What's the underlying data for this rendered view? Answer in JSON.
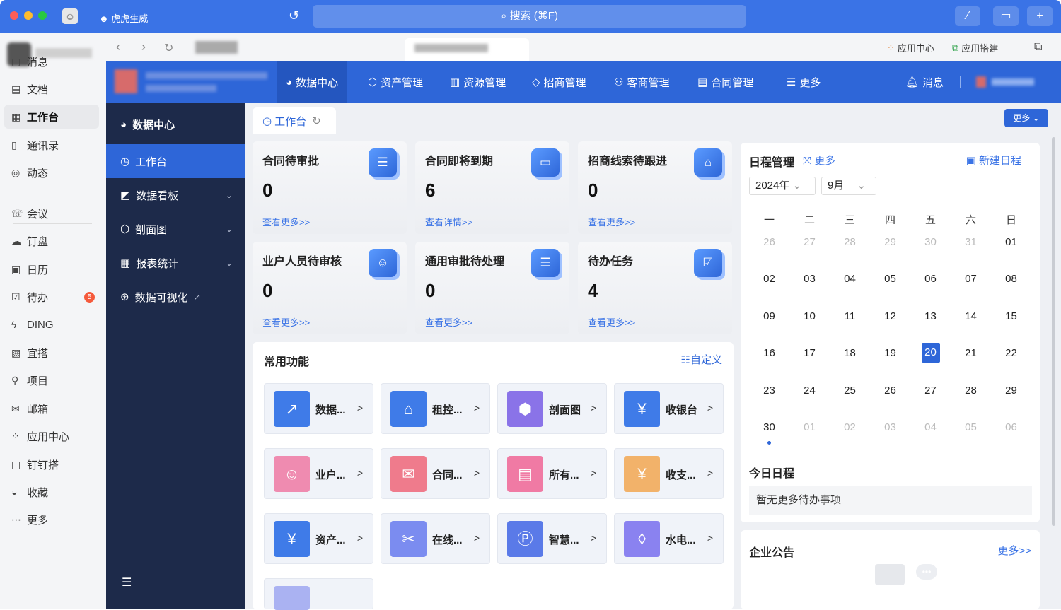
{
  "titlebar": {
    "app_name": "虎虎生威",
    "search_label": "搜索 (⌘F)"
  },
  "tabbar": {
    "app_center": "应用中心",
    "app_builder": "应用搭建"
  },
  "rail": {
    "items": [
      {
        "icon": "message-icon",
        "glyph": "▢",
        "label": "消息"
      },
      {
        "icon": "document-icon",
        "glyph": "▤",
        "label": "文档"
      },
      {
        "icon": "workbench-icon",
        "glyph": "▦",
        "label": "工作台"
      },
      {
        "icon": "contacts-icon",
        "glyph": "▯",
        "label": "通讯录"
      },
      {
        "icon": "activity-icon",
        "glyph": "◎",
        "label": "动态"
      },
      {
        "icon": "meeting-icon",
        "glyph": "☏",
        "label": "会议"
      },
      {
        "icon": "drive-icon",
        "glyph": "☁",
        "label": "钉盘"
      },
      {
        "icon": "calendar-icon",
        "glyph": "▣",
        "label": "日历"
      },
      {
        "icon": "todo-icon",
        "glyph": "☑",
        "label": "待办",
        "badge": "5"
      },
      {
        "icon": "ding-icon",
        "glyph": "ϟ",
        "label": "DING"
      },
      {
        "icon": "yida-icon",
        "glyph": "▧",
        "label": "宜搭"
      },
      {
        "icon": "project-icon",
        "glyph": "⚲",
        "label": "项目"
      },
      {
        "icon": "mail-icon",
        "glyph": "✉",
        "label": "邮箱"
      },
      {
        "icon": "app-center-icon",
        "glyph": "⁘",
        "label": "应用中心"
      },
      {
        "icon": "dingda-icon",
        "glyph": "◫",
        "label": "钉钉搭"
      },
      {
        "icon": "favorites-icon",
        "glyph": "◒",
        "label": "收藏"
      },
      {
        "icon": "more-icon",
        "glyph": "⋯",
        "label": "更多"
      }
    ]
  },
  "topnav": [
    {
      "icon": "pie-icon",
      "glyph": "◕",
      "label": "数据中心"
    },
    {
      "icon": "cube-icon",
      "glyph": "⬡",
      "label": "资产管理"
    },
    {
      "icon": "building-icon",
      "glyph": "▥",
      "label": "资源管理"
    },
    {
      "icon": "tag-icon",
      "glyph": "◇",
      "label": "招商管理"
    },
    {
      "icon": "customer-icon",
      "glyph": "⚇",
      "label": "客商管理"
    },
    {
      "icon": "contract-icon",
      "glyph": "▤",
      "label": "合同管理"
    },
    {
      "icon": "menu-icon",
      "glyph": "☰",
      "label": "更多"
    }
  ],
  "header_right": {
    "messages": "消息"
  },
  "sidenav": {
    "title": "数据中心",
    "items": [
      {
        "icon": "dashboard-icon",
        "glyph": "◷",
        "label": "工作台"
      },
      {
        "icon": "chart-board-icon",
        "glyph": "◩",
        "label": "数据看板"
      },
      {
        "icon": "section-icon",
        "glyph": "⬡",
        "label": "剖面图"
      },
      {
        "icon": "report-icon",
        "glyph": "▦",
        "label": "报表统计"
      },
      {
        "icon": "visual-icon",
        "glyph": "⊛",
        "label": "数据可视化"
      }
    ]
  },
  "main": {
    "worktab": "工作台",
    "more_btn": "更多",
    "cards": [
      {
        "title": "合同待审批",
        "value": "0",
        "link": "查看更多>>",
        "glyph": "☰"
      },
      {
        "title": "合同即将到期",
        "value": "6",
        "link": "查看详情>>",
        "glyph": "▭"
      },
      {
        "title": "招商线索待跟进",
        "value": "0",
        "link": "查看更多>>",
        "glyph": "⌂"
      },
      {
        "title": "业户人员待审核",
        "value": "0",
        "link": "查看更多>>",
        "glyph": "☺"
      },
      {
        "title": "通用审批待处理",
        "value": "0",
        "link": "查看更多>>",
        "glyph": "☰"
      },
      {
        "title": "待办任务",
        "value": "4",
        "link": "查看更多>>",
        "glyph": "☑"
      }
    ],
    "functions": {
      "title": "常用功能",
      "customize": "自定义",
      "items": [
        {
          "label": "数据...",
          "icon": "data-icon",
          "glyph": "↗",
          "color": "#3f7be8"
        },
        {
          "label": "租控...",
          "icon": "rent-icon",
          "glyph": "⌂",
          "color": "#3f7be8"
        },
        {
          "label": "剖面图",
          "icon": "box-icon",
          "glyph": "⬢",
          "color": "#8a73e8"
        },
        {
          "label": "收银台",
          "icon": "cashier-icon",
          "glyph": "¥",
          "color": "#3f7be8"
        },
        {
          "label": "业户...",
          "icon": "tenant-icon",
          "glyph": "☺",
          "color": "#ef8bb0"
        },
        {
          "label": "合同...",
          "icon": "envelope-icon",
          "glyph": "✉",
          "color": "#ef7b8c"
        },
        {
          "label": "所有...",
          "icon": "schedule-icon",
          "glyph": "▤",
          "color": "#f07aa4"
        },
        {
          "label": "收支...",
          "icon": "money-bag-icon",
          "glyph": "¥",
          "color": "#f2b26a"
        },
        {
          "label": "资产...",
          "icon": "coins-icon",
          "glyph": "¥",
          "color": "#3f7be8"
        },
        {
          "label": "在线...",
          "icon": "tools-icon",
          "glyph": "✂",
          "color": "#7b8cf0"
        },
        {
          "label": "智慧...",
          "icon": "parking-icon",
          "glyph": "Ⓟ",
          "color": "#5a7ae8"
        },
        {
          "label": "水电...",
          "icon": "drop-icon",
          "glyph": "◊",
          "color": "#8a82f0"
        }
      ]
    },
    "calendar": {
      "title": "日程管理",
      "more": "更多",
      "new": "新建日程",
      "year": "2024年",
      "month": "9月",
      "weekdays": [
        "一",
        "二",
        "三",
        "四",
        "五",
        "六",
        "日"
      ],
      "days": [
        "26",
        "27",
        "28",
        "29",
        "30",
        "31",
        "01",
        "02",
        "03",
        "04",
        "05",
        "06",
        "07",
        "08",
        "09",
        "10",
        "11",
        "12",
        "13",
        "14",
        "15",
        "16",
        "17",
        "18",
        "19",
        "20",
        "21",
        "22",
        "23",
        "24",
        "25",
        "26",
        "27",
        "28",
        "29",
        "30",
        "01",
        "02",
        "03",
        "04",
        "05",
        "06"
      ],
      "muted_first": 6,
      "muted_last_from": 36,
      "today_index": 25,
      "today_title": "今日日程",
      "today_empty": "暂无更多待办事项"
    },
    "notice": {
      "title": "企业公告",
      "more": "更多>>"
    }
  }
}
